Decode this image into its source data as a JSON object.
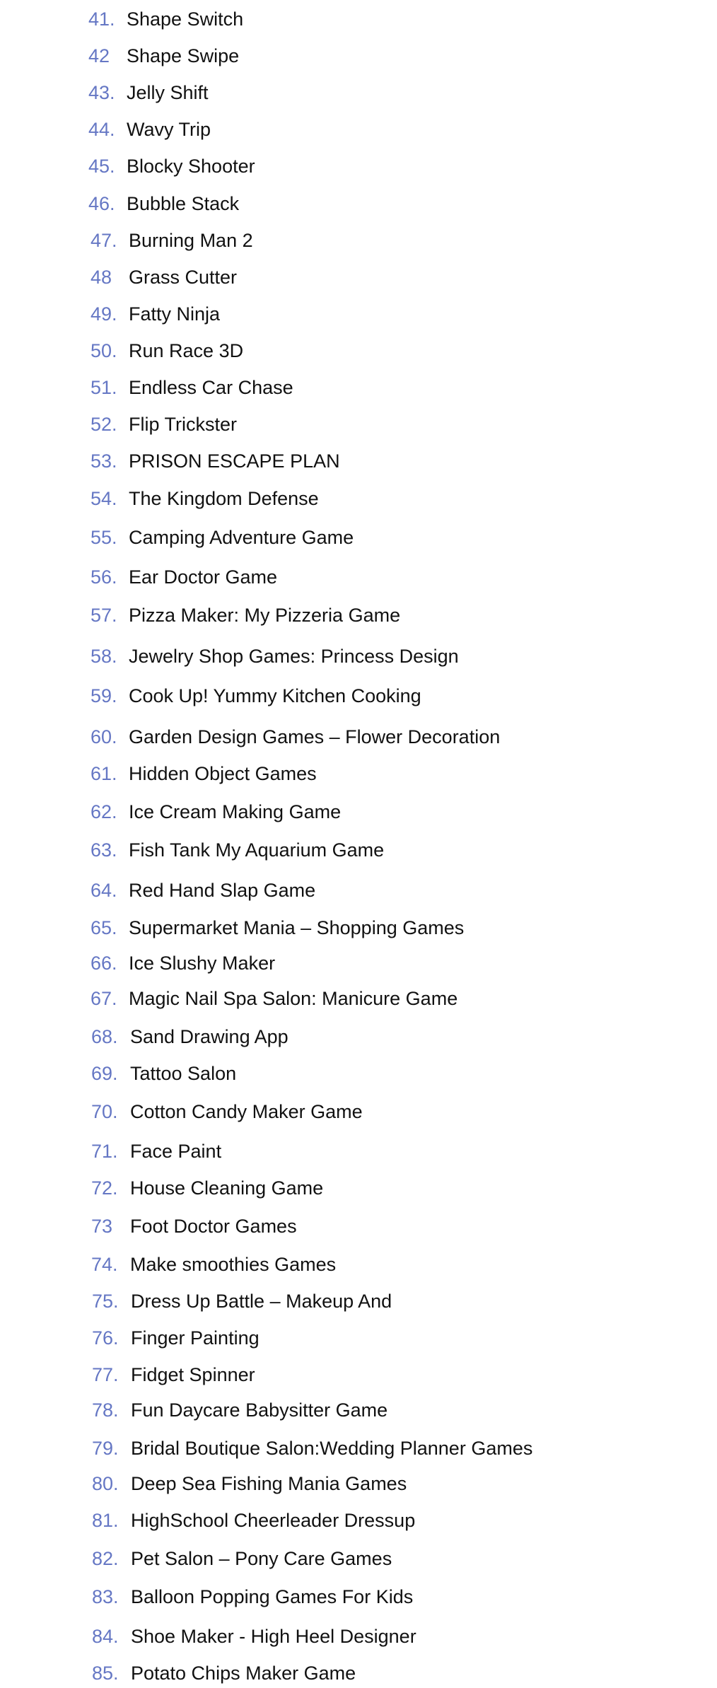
{
  "list": {
    "number_color": "#6577c4",
    "items": [
      {
        "number": "41.",
        "text": "Shape Switch"
      },
      {
        "number": "42",
        "text": "Shape Swipe"
      },
      {
        "number": "43.",
        "text": "Jelly Shift"
      },
      {
        "number": "44.",
        "text": "Wavy Trip"
      },
      {
        "number": "45.",
        "text": "Blocky Shooter"
      },
      {
        "number": "46.",
        "text": "Bubble Stack"
      },
      {
        "number": "47.",
        "text": "Burning Man 2"
      },
      {
        "number": "48",
        "text": "Grass Cutter"
      },
      {
        "number": "49.",
        "text": "Fatty Ninja"
      },
      {
        "number": "50.",
        "text": "Run Race 3D"
      },
      {
        "number": "51.",
        "text": "Endless Car Chase"
      },
      {
        "number": "52.",
        "text": "Flip Trickster"
      },
      {
        "number": "53.",
        "text": "PRISON ESCAPE PLAN"
      },
      {
        "number": "54.",
        "text": "The Kingdom Defense"
      },
      {
        "number": "55.",
        "text": "Camping Adventure Game"
      },
      {
        "number": "56.",
        "text": "Ear Doctor Game"
      },
      {
        "number": "57.",
        "text": "Pizza Maker: My Pizzeria Game"
      },
      {
        "number": "58.",
        "text": "Jewelry Shop Games: Princess Design"
      },
      {
        "number": "59.",
        "text": "Cook Up! Yummy Kitchen Cooking"
      },
      {
        "number": "60.",
        "text": "Garden Design Games – Flower Decoration"
      },
      {
        "number": "61.",
        "text": "Hidden Object Games"
      },
      {
        "number": "62.",
        "text": "Ice Cream Making Game"
      },
      {
        "number": "63.",
        "text": "Fish Tank My Aquarium Game"
      },
      {
        "number": "64.",
        "text": "Red Hand Slap Game"
      },
      {
        "number": "65.",
        "text": "Supermarket Mania – Shopping Games"
      },
      {
        "number": "66.",
        "text": "Ice Slushy Maker"
      },
      {
        "number": "67.",
        "text": "Magic Nail Spa Salon: Manicure Game"
      },
      {
        "number": "68.",
        "text": "Sand Drawing App"
      },
      {
        "number": "69.",
        "text": "Tattoo Salon"
      },
      {
        "number": "70.",
        "text": "Cotton Candy Maker Game"
      },
      {
        "number": "71.",
        "text": "Face Paint"
      },
      {
        "number": "72.",
        "text": "House Cleaning Game"
      },
      {
        "number": "73",
        "text": "Foot Doctor Games"
      },
      {
        "number": "74.",
        "text": "Make smoothies Games"
      },
      {
        "number": "75.",
        "text": "Dress Up Battle – Makeup And"
      },
      {
        "number": "76.",
        "text": "Finger Painting"
      },
      {
        "number": "77.",
        "text": "Fidget Spinner"
      },
      {
        "number": "78.",
        "text": "Fun Daycare Babysitter Game"
      },
      {
        "number": "79.",
        "text": "Bridal Boutique Salon:Wedding Planner Games"
      },
      {
        "number": "80.",
        "text": "Deep Sea Fishing Mania Games"
      },
      {
        "number": "81.",
        "text": "HighSchool Cheerleader Dressup"
      },
      {
        "number": "82.",
        "text": "Pet Salon – Pony Care Games"
      },
      {
        "number": "83.",
        "text": "Balloon Popping Games For Kids"
      },
      {
        "number": "84.",
        "text": "Shoe Maker - High Heel Designer"
      },
      {
        "number": "85.",
        "text": "Potato Chips Maker Game"
      }
    ]
  }
}
